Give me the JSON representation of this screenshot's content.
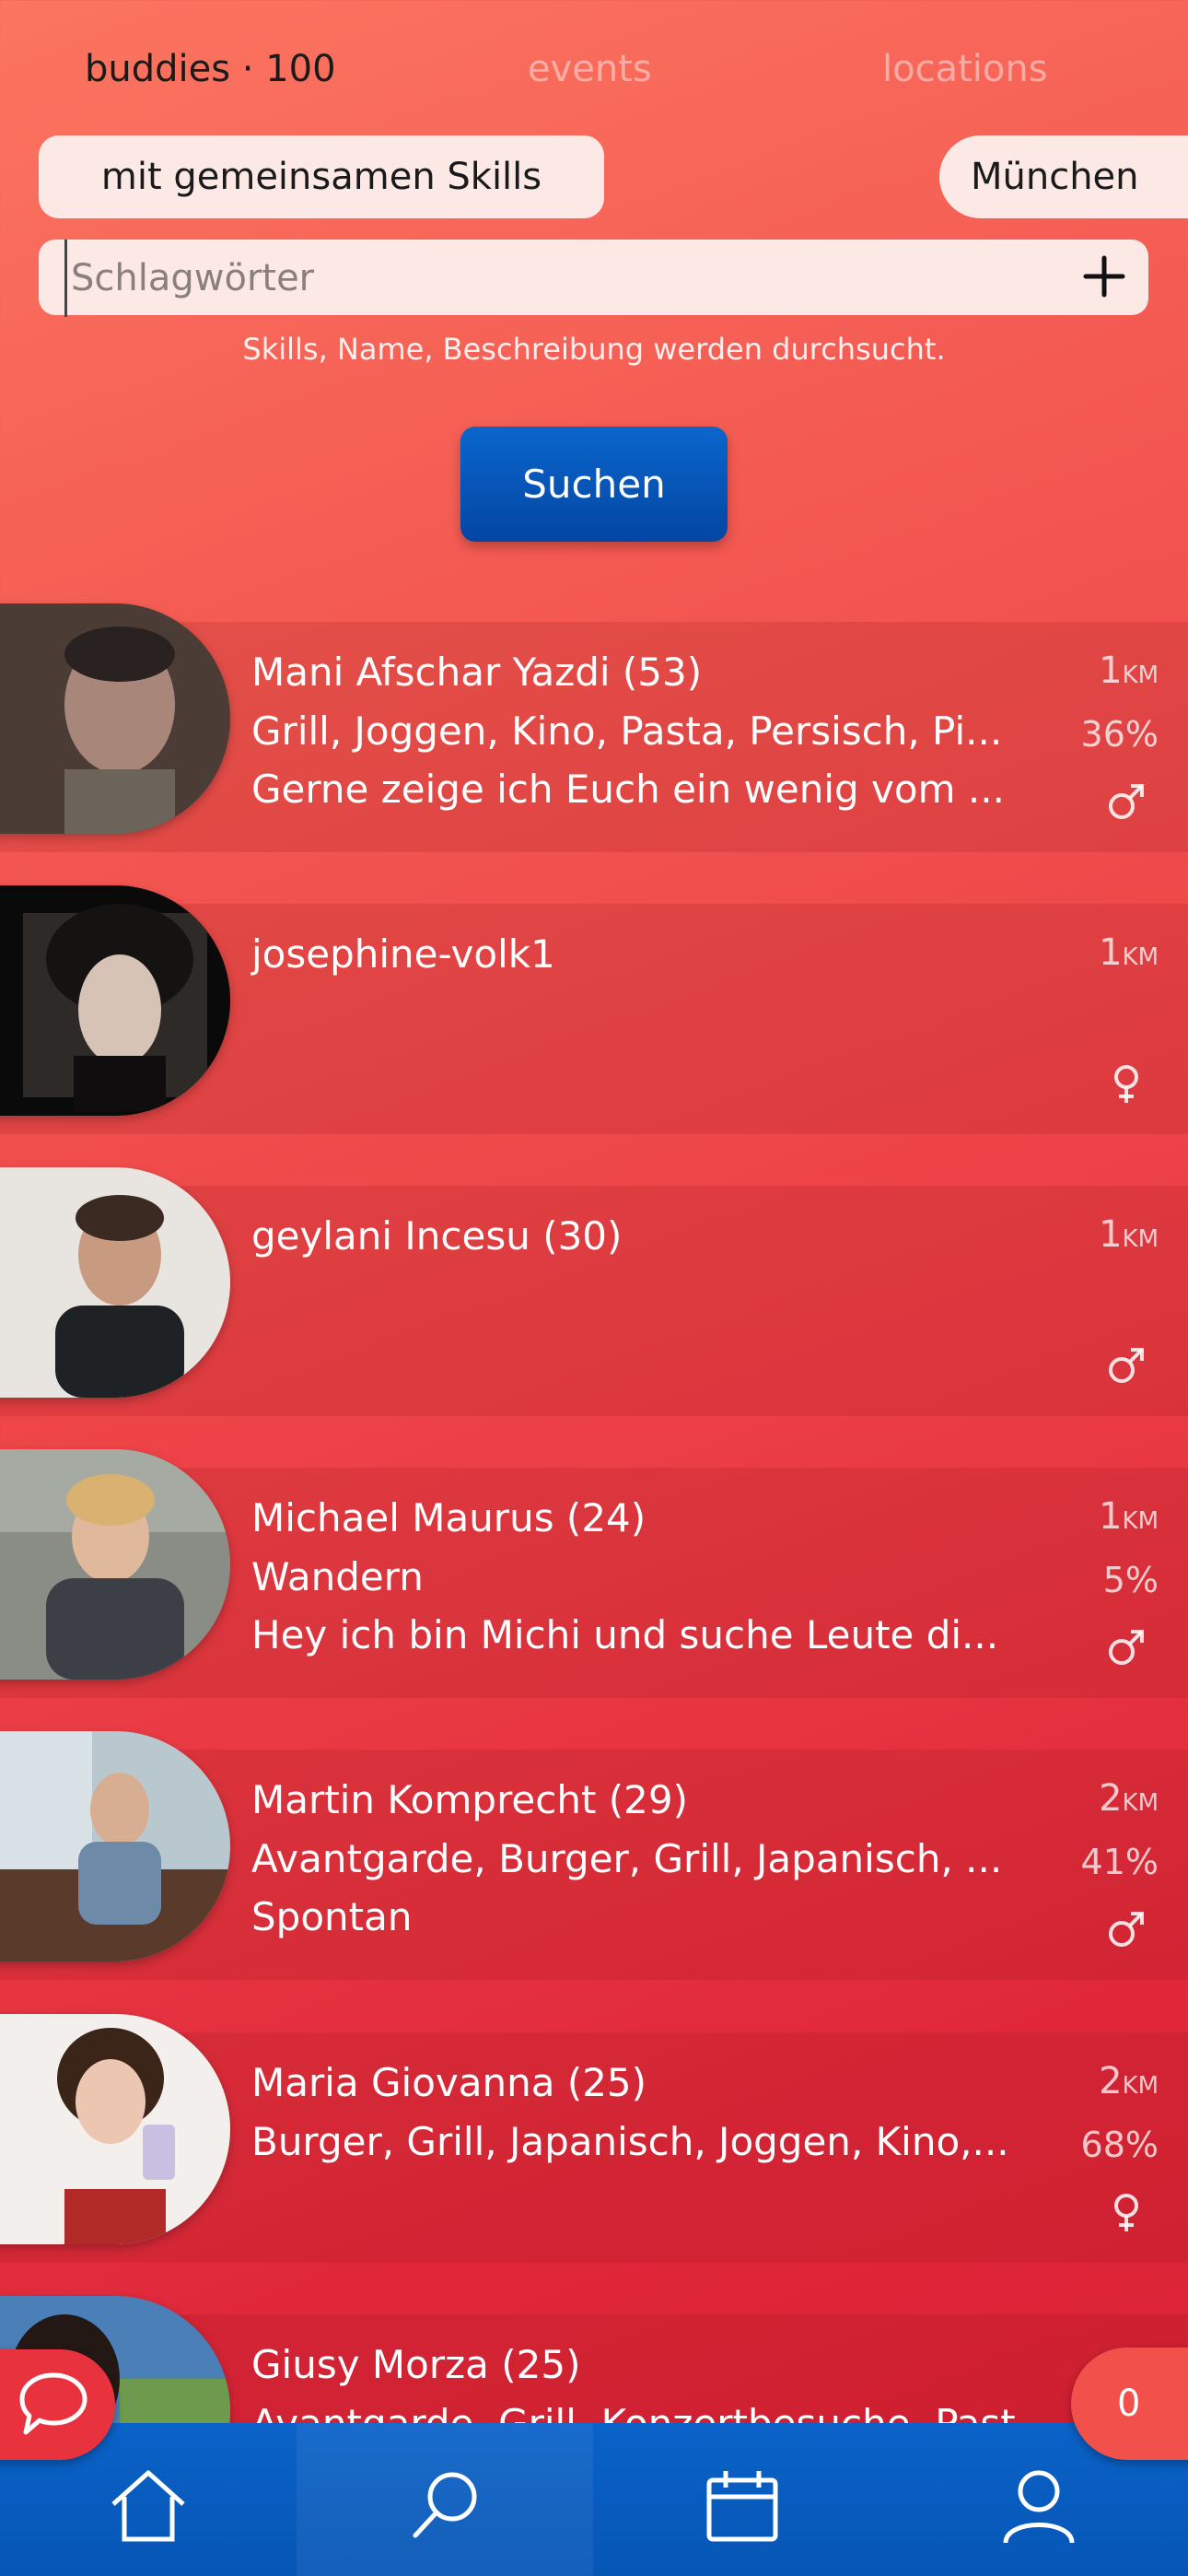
{
  "tabs": [
    {
      "label": "buddies · 100",
      "active": true
    },
    {
      "label": "events",
      "active": false
    },
    {
      "label": "locations",
      "active": false
    }
  ],
  "filters": {
    "skills_pill": "mit gemeinsamen Skills",
    "city_pill": "München"
  },
  "search": {
    "placeholder": "Schlagwörter",
    "value": "",
    "hint": "Skills, Name, Beschreibung werden durchsucht.",
    "button_label": "Suchen"
  },
  "people": [
    {
      "name": "Mani Afschar Yazdi (53)",
      "skills": "Grill, Joggen, Kino, Pasta, Persisch, Pi...",
      "description": "Gerne zeige ich Euch ein wenig vom ...",
      "distance": "1",
      "unit": "KM",
      "match": "36%",
      "gender": "male"
    },
    {
      "name": "josephine-volk1",
      "skills": "",
      "description": "",
      "distance": "1",
      "unit": "KM",
      "match": "",
      "gender": "female"
    },
    {
      "name": "geylani Incesu (30)",
      "skills": "",
      "description": "",
      "distance": "1",
      "unit": "KM",
      "match": "",
      "gender": "male"
    },
    {
      "name": "Michael Maurus (24)",
      "skills": "Wandern",
      "description": "Hey ich bin Michi und suche Leute di...",
      "distance": "1",
      "unit": "KM",
      "match": "5%",
      "gender": "male"
    },
    {
      "name": "Martin Komprecht (29)",
      "skills": "Avantgarde, Burger, Grill, Japanisch, ...",
      "description": "Spontan",
      "distance": "2",
      "unit": "KM",
      "match": "41%",
      "gender": "male"
    },
    {
      "name": "Maria Giovanna (25)",
      "skills": "Burger, Grill, Japanisch, Joggen, Kino,...",
      "description": "",
      "distance": "2",
      "unit": "KM",
      "match": "68%",
      "gender": "female"
    },
    {
      "name": "Giusy Morza (25)",
      "skills": "Avantgarde, Grill, Konzertbesuche, Past...",
      "description": "",
      "distance": "",
      "unit": "",
      "match": "",
      "gender": ""
    }
  ],
  "badge_count": "0",
  "nav": [
    {
      "icon": "home-icon"
    },
    {
      "icon": "search-icon"
    },
    {
      "icon": "calendar-icon"
    },
    {
      "icon": "profile-icon"
    }
  ]
}
